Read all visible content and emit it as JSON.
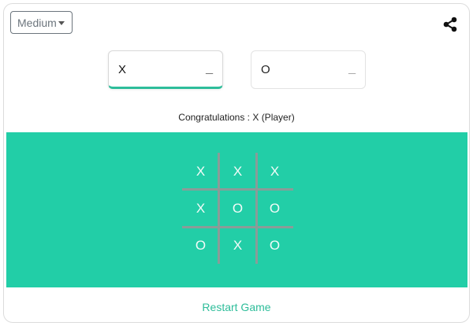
{
  "difficulty": {
    "selected": "Medium"
  },
  "share": {
    "icon": "share-icon"
  },
  "players": [
    {
      "symbol": "X",
      "score": "_",
      "active": true
    },
    {
      "symbol": "O",
      "score": "_",
      "active": false
    }
  ],
  "status": "Congratulations : X (Player)",
  "board": {
    "cells": [
      "X",
      "X",
      "X",
      "X",
      "O",
      "O",
      "O",
      "X",
      "O"
    ]
  },
  "restart_label": "Restart Game",
  "colors": {
    "accent": "#22cea7",
    "accent_text": "#2ebd9a",
    "grid_line": "#8a9c98"
  }
}
